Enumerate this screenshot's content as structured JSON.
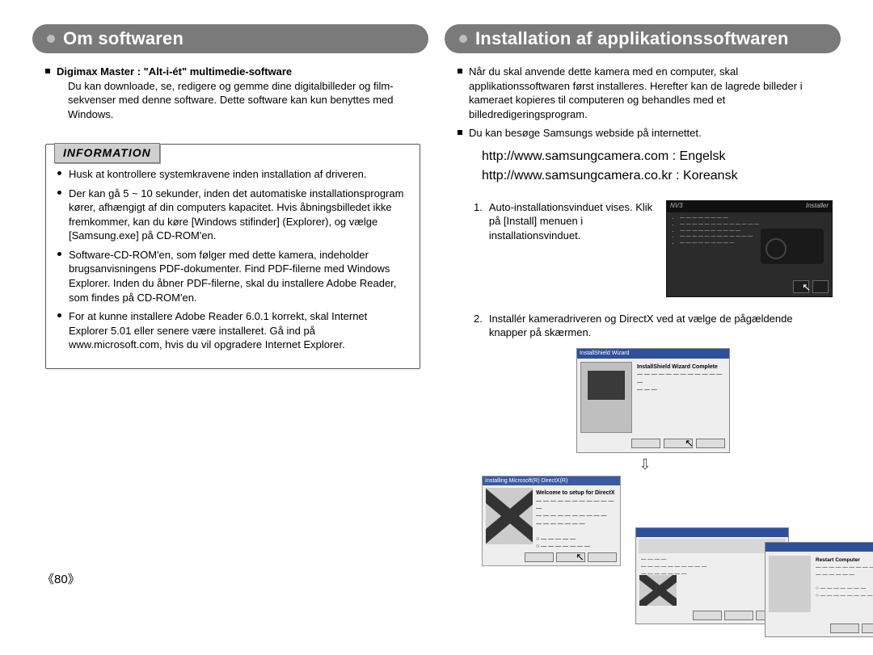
{
  "left": {
    "title": "Om softwaren",
    "section_heading": "Digimax Master : \"Alt-i-ét\" multimedie-software",
    "section_body": "Du kan downloade, se, redigere og gemme dine digitalbilleder og film-sekvenser med denne software. Dette software kan kun benyttes med Windows.",
    "info_label": "INFORMATION",
    "info_items": [
      "Husk at kontrollere systemkravene inden installation af driveren.",
      "Der kan gå 5 ~ 10 sekunder, inden det automatiske installationsprogram kører, afhængigt af din computers kapacitet. Hvis åbningsbilledet ikke fremkommer, kan du køre [Windows stifinder] (Explorer), og vælge [Samsung.exe] på CD-ROM'en.",
      "Software-CD-ROM'en, som følger med dette kamera, indeholder brugsanvisningens PDF-dokumenter. Find PDF-filerne med Windows Explorer. Inden du åbner PDF-filerne, skal du installere Adobe Reader, som findes på CD-ROM'en.",
      "For at kunne installere Adobe Reader 6.0.1 korrekt, skal Internet Explorer 5.01 eller senere være installeret. Gå ind på www.microsoft.com, hvis du vil opgradere Internet Explorer."
    ]
  },
  "right": {
    "title": "Installation af applikationssoftwaren",
    "intro_items": [
      "Når du skal anvende dette kamera med en computer, skal applikationssoftwaren først installeres. Herefter kan de lagrede billeder i kameraet kopieres til computeren og behandles med et billedredigeringsprogram.",
      "Du kan besøge Samsungs webside på internettet."
    ],
    "url1": "http://www.samsungcamera.com : Engelsk",
    "url2": "http://www.samsungcamera.co.kr : Koreansk",
    "step1_num": "1.",
    "step1_text": "Auto-installationsvinduet vises. Klik på [Install] menuen i installationsvinduet.",
    "step2_num": "2.",
    "step2_text": "Installér kameradriveren og DirectX ved at vælge de pågældende knapper på skærmen.",
    "installer_title_left": "NV3",
    "installer_title_right": "Installer",
    "wiz1_title": "InstallShield Wizard",
    "wiz1_heading": "InstallShield Wizard Complete",
    "wiz2_title": "Installing Microsoft(R) DirectX(R)",
    "wiz2_heading": "Welcome to setup for DirectX",
    "wiz3_heading": "Restart Computer"
  },
  "page_number": "80"
}
